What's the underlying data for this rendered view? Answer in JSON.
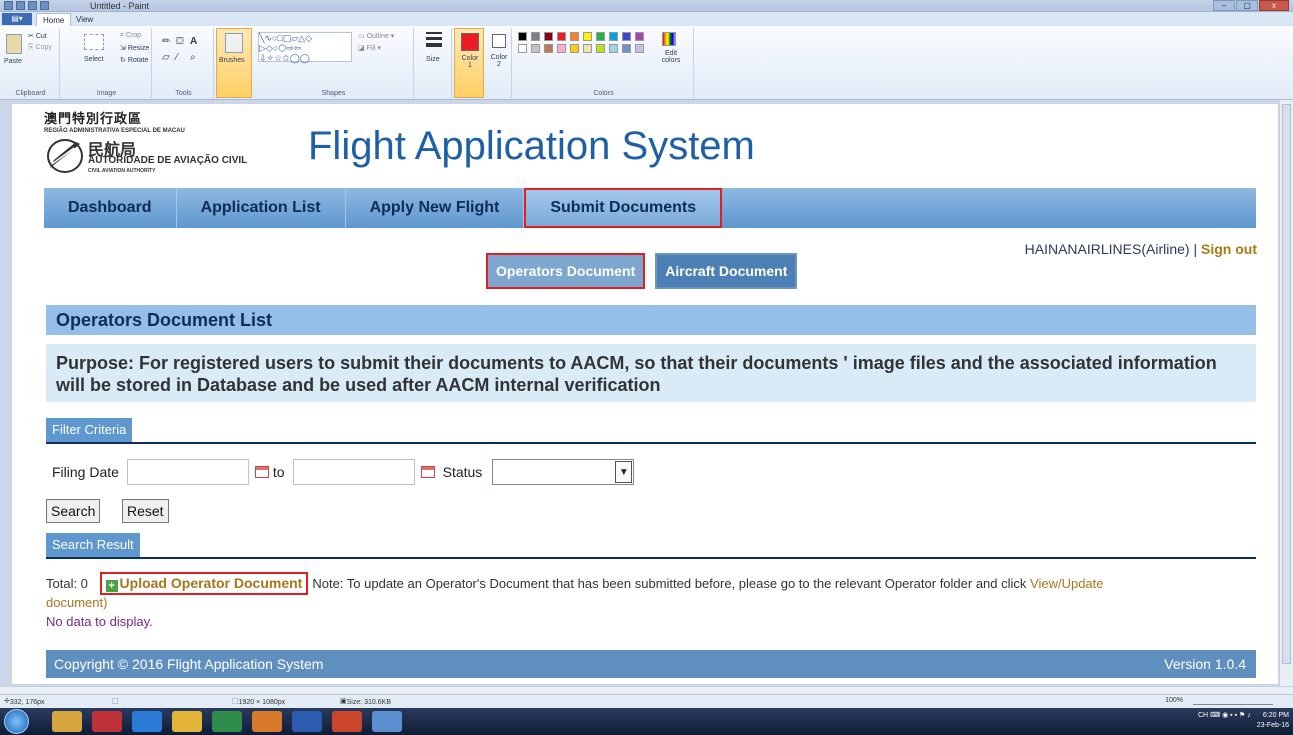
{
  "window": {
    "title": "Untitled - Paint",
    "tabs": [
      "Home",
      "View"
    ],
    "file_button": "",
    "buttons": [
      "–",
      "▢",
      "x"
    ]
  },
  "ribbon": {
    "clipboard": {
      "label": "Clipboard",
      "paste": "Paste",
      "cut": "Cut",
      "copy": "Copy"
    },
    "image": {
      "label": "Image",
      "select": "Select",
      "crop": "Crop",
      "resize": "Resize",
      "rotate": "Rotate"
    },
    "tools": {
      "label": "Tools"
    },
    "brushes": "Brushes",
    "shapes": {
      "label": "Shapes",
      "outline": "Outline",
      "fill": "Fill"
    },
    "size": "Size",
    "color1": "Color 1",
    "color2": "Color 2",
    "colors": {
      "label": "Colors",
      "edit": "Edit colors"
    },
    "palette": [
      "#000000",
      "#7f7f7f",
      "#880015",
      "#ed1c24",
      "#ff7f27",
      "#fff200",
      "#22b14c",
      "#00a2e8",
      "#3f48cc",
      "#a349a4",
      "#ffffff",
      "#c3c3c3",
      "#b97a57",
      "#ffaec9",
      "#ffc90e",
      "#efe4b0",
      "#b5e61d",
      "#99d9ea",
      "#7092be",
      "#c8bfe7"
    ]
  },
  "site": {
    "logo_zh": "澳門特別行政區",
    "logo_pt": "REGIÃO ADMINISTRATIVA ESPECIAL DE MACAU",
    "logo_zh2": "民航局",
    "logo_aac": "AUTORIDADE DE AVIAÇÃO CIVIL",
    "logo_caa": "CIVIL AVIATION AUTHORITY",
    "title": "Flight Application System"
  },
  "nav": {
    "dashboard": "Dashboard",
    "application_list": "Application List",
    "apply_new_flight": "Apply New Flight",
    "submit_documents": "Submit Documents"
  },
  "user": {
    "name": "HAINANAIRLINES(Airline)",
    "separator": "|",
    "sign_out": "Sign out"
  },
  "subnav": {
    "operators": "Operators Document",
    "aircraft": "Aircraft Document"
  },
  "main": {
    "section_title": "Operators Document List",
    "purpose": "Purpose: For registered users to submit their documents to AACM, so that their documents ' image files and the associated information will be stored in Database and be used after AACM internal verification"
  },
  "filter": {
    "header": "Filter Criteria",
    "filing_date": "Filing Date",
    "from_value": "",
    "to_label": "to",
    "to_value": "",
    "status_label": "Status",
    "status_value": "",
    "search": "Search",
    "reset": "Reset"
  },
  "results": {
    "header": "Search Result",
    "total": "Total: 0",
    "upload": "Upload Operator Document",
    "note": "Note: To update an Operator's Document that has been submitted before, please go to the relevant Operator folder and click ",
    "view_update": "View/Update",
    "note_end": "document)",
    "no_data": "No data to display."
  },
  "footer": {
    "copyright": "Copyright © 2016 Flight Application System",
    "version": "Version 1.0.4"
  },
  "statusbar": {
    "position": "332, 176px",
    "dimensions": "1920 × 1080px",
    "size": "Size: 310.6KB",
    "zoom": "100%"
  },
  "tray": {
    "lang": "CH",
    "time": "6:20 PM",
    "date": "23-Feb-16"
  }
}
